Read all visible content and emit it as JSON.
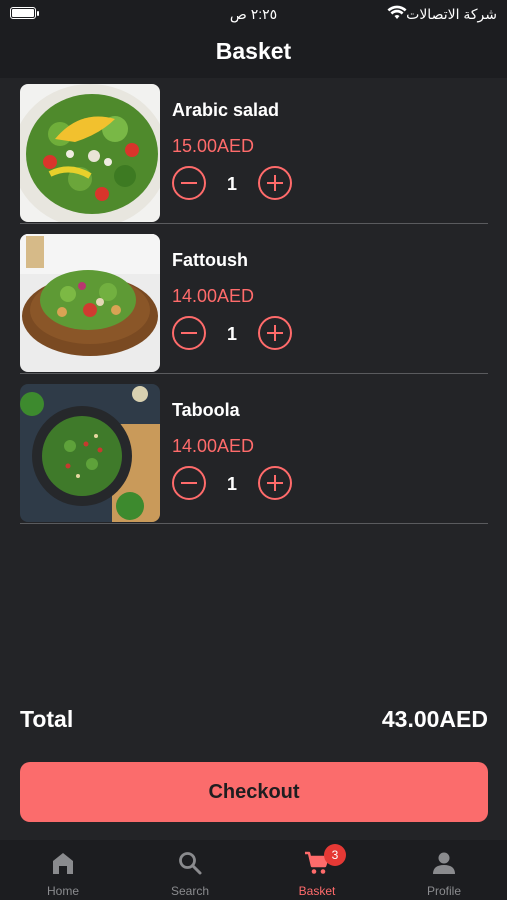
{
  "status_bar": {
    "time": "٢:٢٥ ص",
    "carrier": "شركة الاتصالات"
  },
  "header": {
    "title": "Basket"
  },
  "items": [
    {
      "name": "Arabic salad",
      "price": "15.00AED",
      "quantity": "1"
    },
    {
      "name": "Fattoush",
      "price": "14.00AED",
      "quantity": "1"
    },
    {
      "name": "Taboola",
      "price": "14.00AED",
      "quantity": "1"
    }
  ],
  "summary": {
    "total_label": "Total",
    "total_value": "43.00AED"
  },
  "checkout": {
    "label": "Checkout"
  },
  "tabs": [
    {
      "label": "Home",
      "icon": "home-icon"
    },
    {
      "label": "Search",
      "icon": "search-icon"
    },
    {
      "label": "Basket",
      "icon": "cart-icon",
      "badge": "3",
      "active": true
    },
    {
      "label": "Profile",
      "icon": "person-icon"
    }
  ],
  "colors": {
    "accent": "#ff6b6b",
    "background": "#232427",
    "bar": "#1c1d20",
    "badge": "#e53935"
  }
}
